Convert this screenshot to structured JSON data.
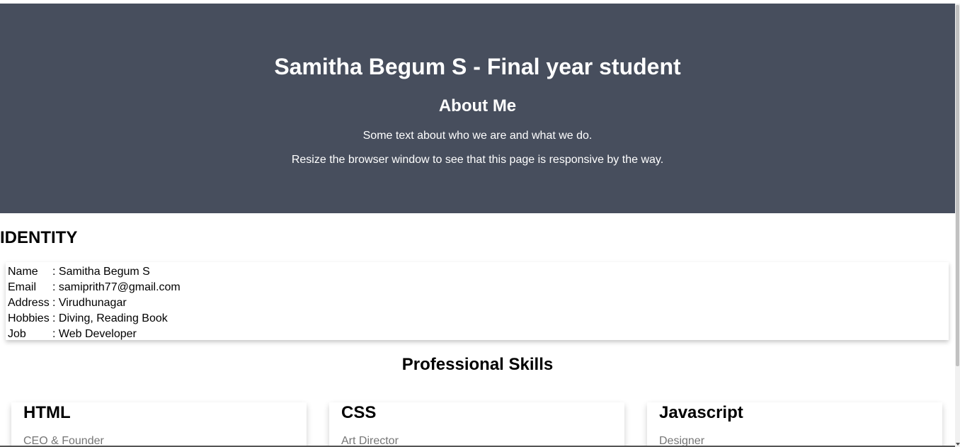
{
  "about": {
    "title": "Samitha Begum S - Final year student",
    "heading": "About Me",
    "paragraph1": "Some text about who we are and what we do.",
    "paragraph2": "Resize the browser window to see that this page is responsive by the way."
  },
  "identity": {
    "heading": "IDENTITY",
    "rows": [
      {
        "label": "Name",
        "value": ": Samitha Begum S"
      },
      {
        "label": "Email",
        "value": ": samiprith77@gmail.com"
      },
      {
        "label": "Address",
        "value": ": Virudhunagar"
      },
      {
        "label": "Hobbies",
        "value": ": Diving, Reading Book"
      },
      {
        "label": "Job",
        "value": ": Web Developer"
      }
    ]
  },
  "skills": {
    "heading": "Professional Skills",
    "cards": [
      {
        "name": "HTML",
        "role": "CEO & Founder"
      },
      {
        "name": "CSS",
        "role": "Art Director"
      },
      {
        "name": "Javascript",
        "role": "Designer"
      }
    ]
  },
  "colors": {
    "header_bg": "#474e5d",
    "header_text": "#ffffff",
    "role_text": "#757575"
  }
}
